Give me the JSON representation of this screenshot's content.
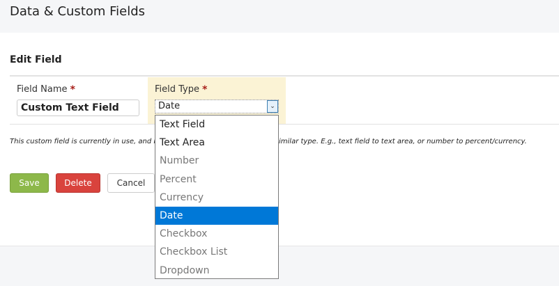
{
  "header": {
    "title": "Data & Custom Fields"
  },
  "section": {
    "title": "Edit Field"
  },
  "field_name": {
    "label": "Field Name",
    "required": "*",
    "value": "Custom Text Field"
  },
  "field_type": {
    "label": "Field Type",
    "required": "*",
    "value": "Date",
    "options": [
      {
        "label": "Text Field",
        "enabled": true
      },
      {
        "label": "Text Area",
        "enabled": true
      },
      {
        "label": "Number",
        "enabled": false
      },
      {
        "label": "Percent",
        "enabled": false
      },
      {
        "label": "Currency",
        "enabled": false
      },
      {
        "label": "Date",
        "enabled": true,
        "selected": true
      },
      {
        "label": "Checkbox",
        "enabled": false
      },
      {
        "label": "Checkbox List",
        "enabled": false
      },
      {
        "label": "Dropdown",
        "enabled": false
      }
    ]
  },
  "note": {
    "visible_left": "This custom field is currently in use, and its",
    "visible_right": "imilar type. E.g., text field to text area, or number to percent/currency."
  },
  "buttons": {
    "save": "Save",
    "delete": "Delete",
    "cancel": "Cancel"
  },
  "colors": {
    "save": "#8db84a",
    "delete": "#d9433d",
    "selected": "#0078d7",
    "panel": "#fbf3d5"
  }
}
